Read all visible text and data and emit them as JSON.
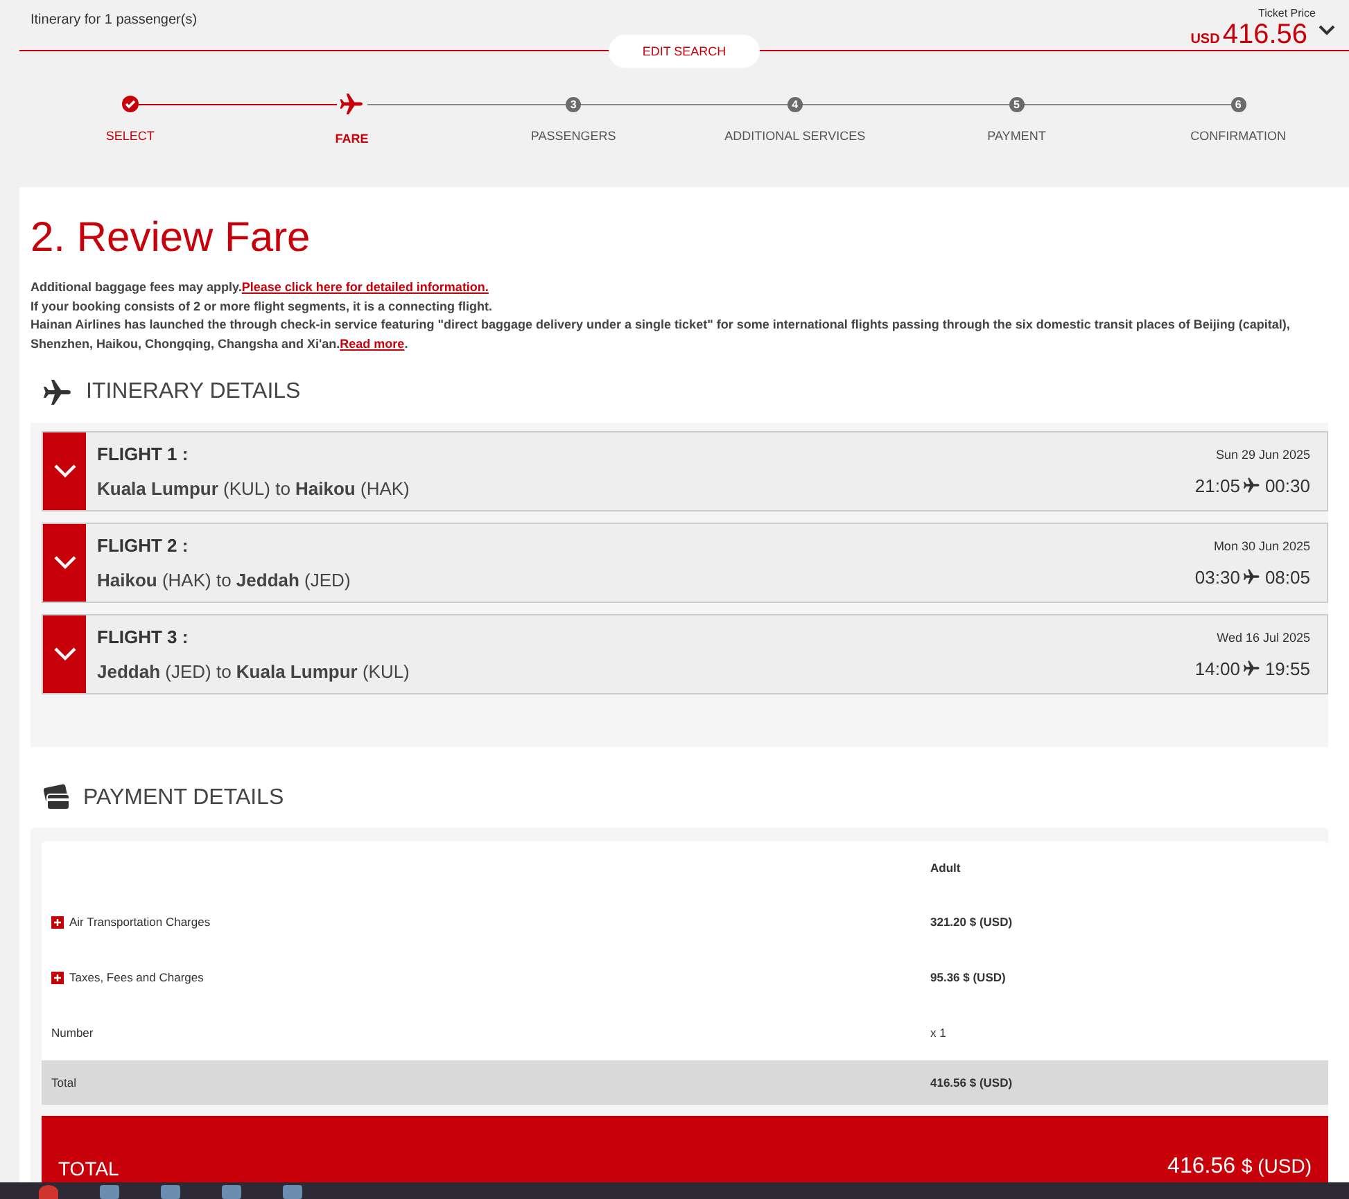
{
  "header": {
    "itinerary_label": "Itinerary for 1 passenger(s)",
    "ticket_price_label": "Ticket Price",
    "currency": "USD",
    "price": "416.56",
    "edit_search": "EDIT SEARCH"
  },
  "steps": [
    {
      "label": "SELECT",
      "completed": true,
      "selected": false
    },
    {
      "label": "FARE",
      "completed": false,
      "selected": true
    },
    {
      "label": "PASSENGERS",
      "completed": false,
      "selected": false,
      "number": "3"
    },
    {
      "label": "ADDITIONAL SERVICES",
      "completed": false,
      "selected": false,
      "number": "4"
    },
    {
      "label": "PAYMENT",
      "completed": false,
      "selected": false,
      "number": "5"
    },
    {
      "label": "CONFIRMATION",
      "completed": false,
      "selected": false,
      "number": "6"
    }
  ],
  "page_title": "2. Review Fare",
  "notices": [
    {
      "text": "Additional baggage fees may apply.",
      "link": "Please click here for detailed information."
    },
    {
      "text": "If your booking consists of 2 or more flight segments, it is a connecting flight."
    },
    {
      "text": "Hainan Airlines has launched the through check-in service featuring \"direct baggage delivery under a single ticket\" for some international flights passing through the six domestic transit places of Beijing (capital), Shenzhen, Haikou, Chongqing, Changsha and Xi'an.",
      "link": "Read more",
      "after": "."
    }
  ],
  "itinerary": {
    "heading": "ITINERARY DETAILS",
    "flights": [
      {
        "label": "FLIGHT 1 :",
        "route": "**Kuala Lumpur** (KUL) to **Haikou** (HAK)",
        "date": "Sun 29 Jun 2025",
        "depart": "21:05",
        "arrive": "00:30",
        "expanded": false
      },
      {
        "label": "FLIGHT 2 :",
        "route": "**Haikou** (HAK) to **Jeddah** (JED)",
        "date": "Mon 30 Jun 2025",
        "depart": "03:30",
        "arrive": "08:05",
        "expanded": false
      },
      {
        "label": "FLIGHT 3 :",
        "route": "**Jeddah** (JED) to **Kuala Lumpur** (KUL)",
        "date": "Wed 16 Jul 2025",
        "depart": "14:00",
        "arrive": "19:55",
        "expanded": false
      }
    ]
  },
  "payment": {
    "heading": "PAYMENT DETAILS",
    "column_header": "Adult",
    "rows": [
      {
        "kind": "charge",
        "label": "Air Transportation Charges",
        "value": "321.20 $ (USD)"
      },
      {
        "kind": "charge",
        "label": "Taxes, Fees and Charges",
        "value": "95.36 $ (USD)"
      },
      {
        "kind": "plain",
        "label": "Number",
        "value": "x 1"
      },
      {
        "kind": "total",
        "label": "Total",
        "value": "416.56 $ (USD)"
      }
    ],
    "total_label": "TOTAL",
    "total_amount": "416.56",
    "total_currency": "$ (USD)"
  }
}
